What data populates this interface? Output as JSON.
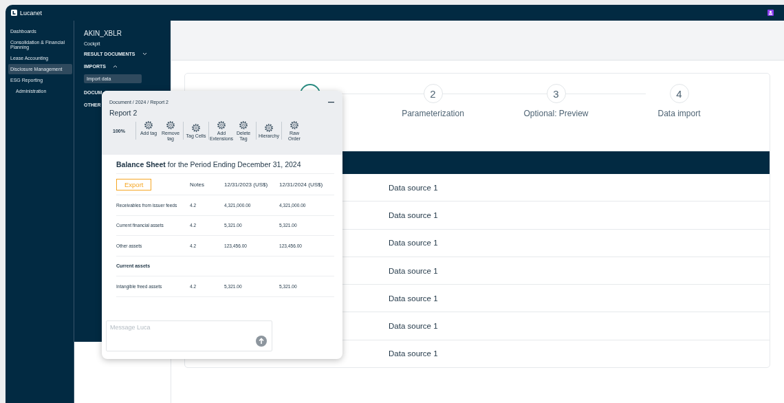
{
  "top_bar": {
    "logo_text": "Lucanet"
  },
  "nav": {
    "items": [
      {
        "label": "Dashboards",
        "selected": false,
        "kind": "item"
      },
      {
        "label": "Consolidation & Financial Planning",
        "selected": false,
        "kind": "item"
      },
      {
        "label": "Lease Accounting",
        "selected": false,
        "kind": "item"
      },
      {
        "label": "Disclosure Management",
        "selected": true,
        "kind": "item"
      },
      {
        "label": "ESG Reporting",
        "selected": false,
        "kind": "item"
      },
      {
        "label": "Administration",
        "selected": false,
        "kind": "sub"
      }
    ]
  },
  "flyout": {
    "title": "AKIN_XBLR",
    "items": [
      {
        "kind": "link",
        "label": "Cockpit"
      },
      {
        "kind": "section",
        "label": "RESULT DOCUMENTS",
        "expanded": false
      },
      {
        "kind": "section",
        "label": "IMPORTS",
        "expanded": true
      },
      {
        "kind": "sub",
        "label": "Import data",
        "selected": true
      },
      {
        "kind": "cut",
        "label": "DOCUM"
      },
      {
        "kind": "cut",
        "label": "OTHER"
      }
    ]
  },
  "steps": [
    {
      "selected": true
    },
    {
      "number": "2",
      "label": "Parameterization",
      "selected": false
    },
    {
      "number": "3",
      "label": "Optional: Preview",
      "selected": false
    },
    {
      "number": "4",
      "label": "Data import",
      "selected": false
    }
  ],
  "data_rows": [
    "Data source 1",
    "Data source 1",
    "Data source 1",
    "Data source 1",
    "Data source 1",
    "Data source 1",
    "Data source 1"
  ],
  "report_panel": {
    "breadcrumb": "Document / 2024 / Report 2",
    "title": "Report 2",
    "zoom": "100%",
    "tool_groups": [
      [
        "Add tag",
        "Remove tag"
      ],
      [
        "Tag Cells"
      ],
      [
        "Add Extensions",
        "Delete Tag"
      ],
      [
        "Hierarchy"
      ],
      [
        "Raw Order"
      ]
    ],
    "heading": "**Balance Sheet** for the Period Ending December 31, 2024",
    "export_button": "Export",
    "columns": [
      "Notes",
      "12/31/2023 (US$)",
      "12/31/2024 (US$)"
    ],
    "rows": [
      {
        "kind": "data",
        "label": "Receivables from issuer feeds",
        "notes": "4.2",
        "y2023": "4,321,000.00",
        "y2024": "4,321,000.00"
      },
      {
        "kind": "data",
        "label": "Current financial assets",
        "notes": "4.2",
        "y2023": "5,321.00",
        "y2024": "5,321.00"
      },
      {
        "kind": "data",
        "label": "Other assets",
        "notes": "4.2",
        "y2023": "123,456.00",
        "y2024": "123,456.00"
      },
      {
        "kind": "heading",
        "label": "Current assets"
      },
      {
        "kind": "data",
        "label": "Intangible freed assets",
        "notes": "4.2",
        "y2023": "5,321.00",
        "y2024": "5,321.00"
      }
    ],
    "message": {
      "placeholder": "Message Luca"
    }
  }
}
